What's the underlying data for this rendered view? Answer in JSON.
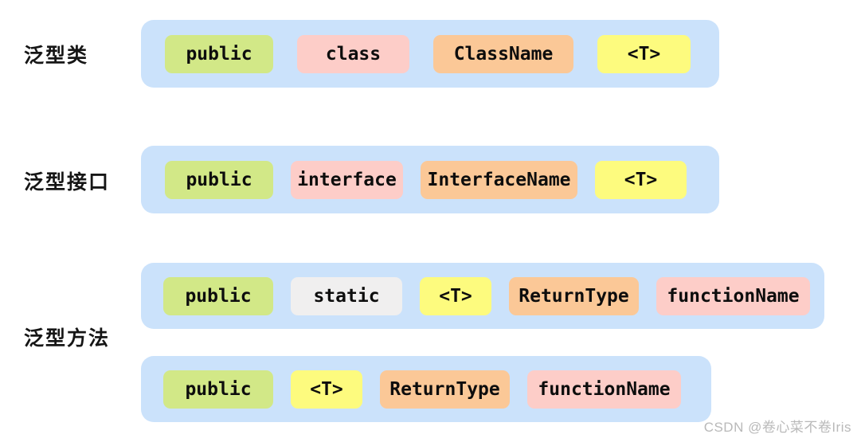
{
  "diagram": {
    "title_watermark": "CSDN @卷心菜不卷Iris",
    "background_color": "#ffffff",
    "bar_color": "#cbe2fb",
    "chip_colors": {
      "green": "#d2e887",
      "pink": "#fdcdc8",
      "orange": "#fbc897",
      "yellow": "#fdfb7e",
      "gray": "#f0efef"
    },
    "labels": [
      {
        "text": "泛型类"
      },
      {
        "text": "泛型接口"
      },
      {
        "text": "泛型方法"
      }
    ],
    "rows": [
      {
        "name": "generic-class",
        "label": "泛型类",
        "chips": [
          {
            "text": "public",
            "color": "green"
          },
          {
            "text": "class",
            "color": "pink"
          },
          {
            "text": "ClassName",
            "color": "orange"
          },
          {
            "text": "<T>",
            "color": "yellow"
          }
        ]
      },
      {
        "name": "generic-interface",
        "label": "泛型接口",
        "chips": [
          {
            "text": "public",
            "color": "green"
          },
          {
            "text": "interface",
            "color": "pink"
          },
          {
            "text": "InterfaceName",
            "color": "orange"
          },
          {
            "text": "<T>",
            "color": "yellow"
          }
        ]
      },
      {
        "name": "generic-method-static",
        "label": "泛型方法",
        "chips": [
          {
            "text": "public",
            "color": "green"
          },
          {
            "text": "static",
            "color": "gray"
          },
          {
            "text": "<T>",
            "color": "yellow"
          },
          {
            "text": "ReturnType",
            "color": "orange"
          },
          {
            "text": "functionName",
            "color": "pink"
          }
        ]
      },
      {
        "name": "generic-method-instance",
        "label": "",
        "chips": [
          {
            "text": "public",
            "color": "green"
          },
          {
            "text": "<T>",
            "color": "yellow"
          },
          {
            "text": "ReturnType",
            "color": "orange"
          },
          {
            "text": "functionName",
            "color": "pink"
          }
        ]
      }
    ]
  }
}
